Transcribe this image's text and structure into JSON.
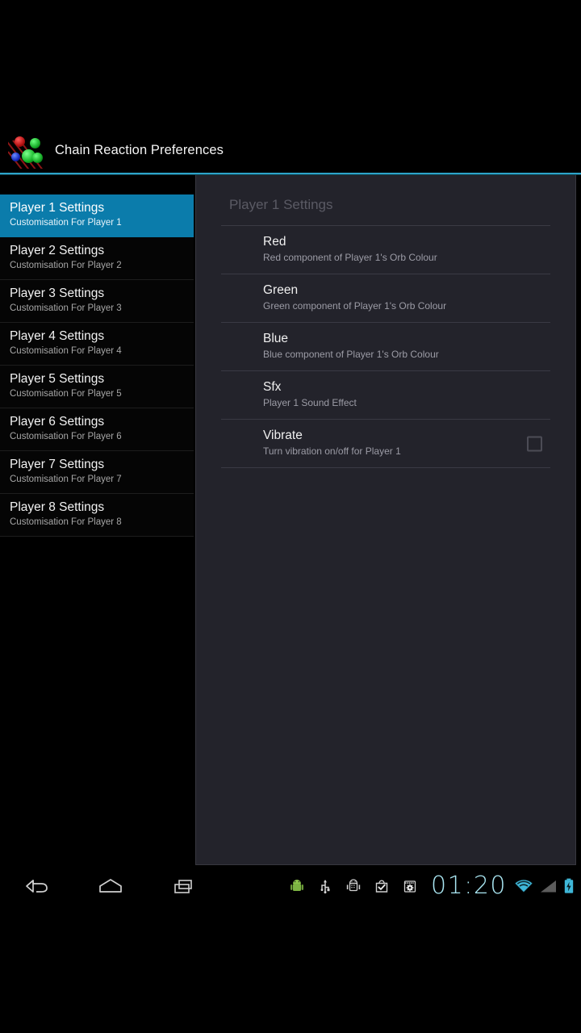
{
  "window": {
    "title": "Chain Reaction Preferences",
    "app_icon": "chain-reaction-orbs-icon",
    "accent_color": "#2da3c9",
    "selected_color": "#0b7cab",
    "panel_bg": "#23232b"
  },
  "sidebar": {
    "items": [
      {
        "title": "Player 1 Settings",
        "subtitle": "Customisation For Player 1",
        "selected": true
      },
      {
        "title": "Player 2 Settings",
        "subtitle": "Customisation For Player 2",
        "selected": false
      },
      {
        "title": "Player 3 Settings",
        "subtitle": "Customisation For Player 3",
        "selected": false
      },
      {
        "title": "Player 4 Settings",
        "subtitle": "Customisation For Player 4",
        "selected": false
      },
      {
        "title": "Player 5 Settings",
        "subtitle": "Customisation For Player 5",
        "selected": false
      },
      {
        "title": "Player 6 Settings",
        "subtitle": "Customisation For Player 6",
        "selected": false
      },
      {
        "title": "Player 7 Settings",
        "subtitle": "Customisation For Player 7",
        "selected": false
      },
      {
        "title": "Player 8 Settings",
        "subtitle": "Customisation For Player 8",
        "selected": false
      }
    ]
  },
  "panel": {
    "header": "Player 1 Settings",
    "preferences": [
      {
        "title": "Red",
        "summary": "Red component of Player 1's Orb Colour",
        "widget": "none"
      },
      {
        "title": "Green",
        "summary": "Green component of Player 1's Orb Colour",
        "widget": "none"
      },
      {
        "title": "Blue",
        "summary": "Blue component of Player 1's Orb Colour",
        "widget": "none"
      },
      {
        "title": "Sfx",
        "summary": "Player 1 Sound Effect",
        "widget": "none"
      },
      {
        "title": "Vibrate",
        "summary": "Turn vibration on/off for Player 1",
        "widget": "checkbox",
        "checked": false
      }
    ]
  },
  "system_bar": {
    "nav": [
      {
        "name": "back-icon",
        "label": "Back"
      },
      {
        "name": "home-icon",
        "label": "Home"
      },
      {
        "name": "recents-icon",
        "label": "Recent apps"
      }
    ],
    "notifications": [
      {
        "name": "android-robot-icon"
      },
      {
        "name": "usb-icon"
      },
      {
        "name": "usb-debugging-icon"
      },
      {
        "name": "play-store-check-icon"
      },
      {
        "name": "settings-gear-icon"
      }
    ],
    "clock": "01:20",
    "clock_color": "#a9e6f2",
    "wifi": {
      "name": "wifi-icon",
      "color": "#3fb7d8"
    },
    "signal": {
      "name": "signal-bars-icon",
      "color": "#6b6b6b"
    },
    "battery": {
      "name": "battery-charging-icon",
      "color": "#3fb7d8"
    }
  }
}
